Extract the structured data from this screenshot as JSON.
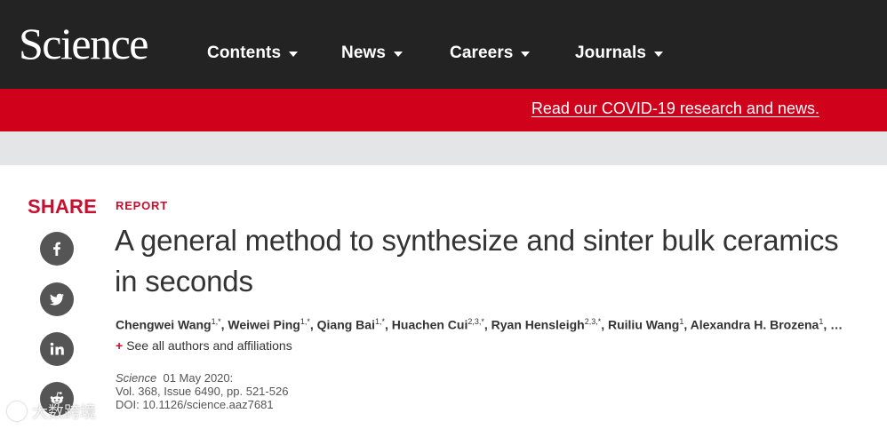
{
  "header": {
    "logo": "Science",
    "nav": [
      {
        "label": "Contents"
      },
      {
        "label": "News"
      },
      {
        "label": "Careers"
      },
      {
        "label": "Journals"
      }
    ]
  },
  "banner": {
    "link_text": "Read our COVID-19 research and news."
  },
  "share": {
    "label": "SHARE",
    "buttons": [
      "facebook-icon",
      "twitter-icon",
      "linkedin-icon",
      "reddit-icon"
    ]
  },
  "article": {
    "type": "REPORT",
    "title": "A general method to synthesize and sinter bulk ceramics in seconds",
    "authors": [
      {
        "name": "Chengwei Wang",
        "aff": "1,*"
      },
      {
        "name": "Weiwei Ping",
        "aff": "1,*"
      },
      {
        "name": "Qiang Bai",
        "aff": "1,*"
      },
      {
        "name": "Huachen Cui",
        "aff": "2,3,*"
      },
      {
        "name": "Ryan Hensleigh",
        "aff": "2,3,*"
      },
      {
        "name": "Ruiliu Wang",
        "aff": "1"
      },
      {
        "name": "Alexandra H. Brozena",
        "aff": "1"
      }
    ],
    "authors_more": "…",
    "see_all": "See all authors and affiliations",
    "journal": "Science",
    "date": "01 May 2020:",
    "volume_line": "Vol. 368, Issue 6490, pp. 521-526",
    "doi_line": "DOI: 10.1126/science.aaz7681"
  },
  "watermark": {
    "text": "大数跨境"
  },
  "colors": {
    "header_bg": "#232323",
    "banner_red": "#d0021b",
    "accent_red": "#c8102e",
    "gray_strip": "#e3e5e6"
  }
}
